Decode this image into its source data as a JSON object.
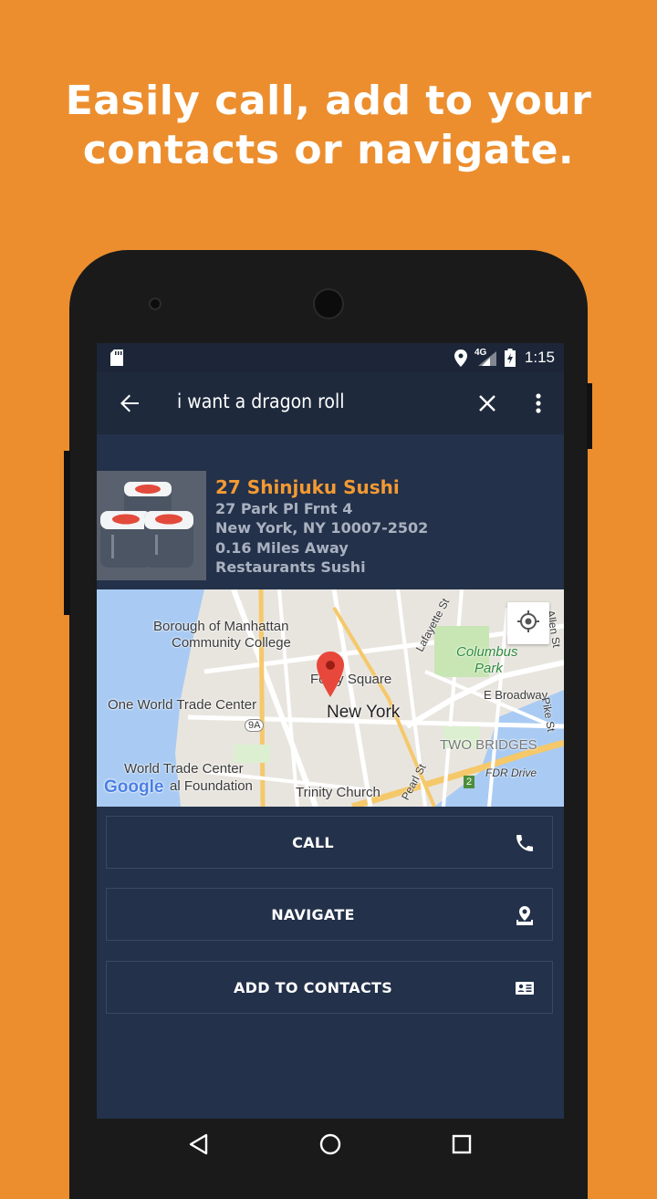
{
  "headline": {
    "line1": "Easily call, add to your",
    "line2": "contacts or navigate."
  },
  "status_bar": {
    "time": "1:15",
    "network": "4G",
    "icons": [
      "sd-card-icon",
      "location-icon",
      "signal-icon",
      "battery-icon"
    ]
  },
  "toolbar": {
    "query": "i want a dragon roll",
    "back_icon": "arrow-back-icon",
    "clear_icon": "close-icon",
    "menu_icon": "more-vert-icon"
  },
  "result": {
    "name": "27 Shinjuku Sushi",
    "address1": "27 Park Pl Frnt 4",
    "address2": "New York, NY 10007-2502",
    "distance": "0.16 Miles Away",
    "category": "Restaurants Sushi"
  },
  "map": {
    "labels": {
      "bmcc": "Borough of Manhattan\nCommunity College",
      "bmcc1": "Borough of Manhattan",
      "bmcc2": "Community College",
      "wtc": "One World Trade Center",
      "foley": "Foley Square",
      "newyork": "New York",
      "columbus1": "Columbus",
      "columbus2": "Park",
      "ebroadway": "E Broadway",
      "twobridges": "TWO BRIDGES",
      "wtcf1": "World Trade Center",
      "wtcf2": "al Foundation",
      "trinity": "Trinity Church",
      "pearl": "Pearl St",
      "fdr": "FDR Drive",
      "lafayette": "Lafayette St",
      "allen": "Allen St",
      "pike": "Pike St",
      "route9a": "9A",
      "route2": "2",
      "google": "Google"
    }
  },
  "actions": [
    {
      "label": "CALL",
      "icon": "phone-icon"
    },
    {
      "label": "NAVIGATE",
      "icon": "place-icon"
    },
    {
      "label": "ADD TO CONTACTS",
      "icon": "contact-card-icon"
    }
  ],
  "colors": {
    "background": "#EC8E2E",
    "accent": "#F39A33",
    "screen": "#23314A",
    "toolbar": "#1E293C"
  }
}
